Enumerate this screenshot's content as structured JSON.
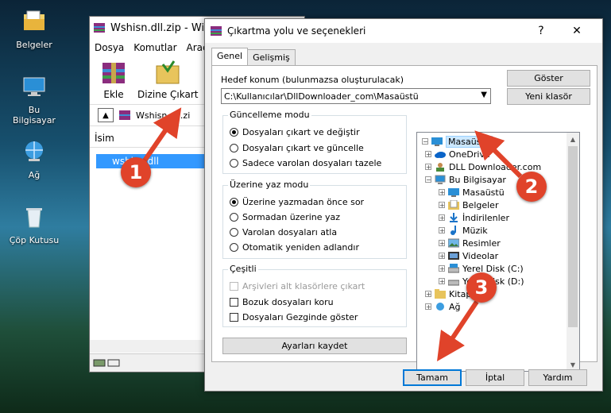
{
  "desktop": {
    "icons": [
      {
        "label": "Belgeler",
        "icon": "folder-documents-icon"
      },
      {
        "label": "Bu Bilgisayar",
        "icon": "computer-icon"
      },
      {
        "label": "Ağ",
        "icon": "network-icon"
      },
      {
        "label": "Çöp Kutusu",
        "icon": "recycle-bin-icon"
      }
    ]
  },
  "winrar": {
    "title": "Wshisn.dll.zip - WinR",
    "menu": [
      "Dosya",
      "Komutlar",
      "Araçla"
    ],
    "toolbar": {
      "add_label": "Ekle",
      "extract_label": "Dizine Çıkart"
    },
    "address": "Wshisn.dll.zi",
    "column_name": "İsim",
    "file_name": "wshisn.dll"
  },
  "dialog": {
    "title": "Çıkartma yolu ve seçenekleri",
    "help_glyph": "?",
    "close_glyph": "✕",
    "tabs": [
      "Genel",
      "Gelişmiş"
    ],
    "dest_label": "Hedef konum (bulunmazsa oluşturulacak)",
    "dest_value": "C:\\Kullanıcılar\\DllDownloader_com\\Masaüstü",
    "show_button": "Göster",
    "new_folder_button": "Yeni klasör",
    "update_mode": {
      "title": "Güncelleme modu",
      "options": [
        "Dosyaları çıkart ve değiştir",
        "Dosyaları çıkart ve güncelle",
        "Sadece varolan dosyaları tazele"
      ],
      "selected": 0
    },
    "overwrite_mode": {
      "title": "Üzerine yaz modu",
      "options": [
        "Üzerine yazmadan önce sor",
        "Sormadan üzerine yaz",
        "Varolan dosyaları atla",
        "Otomatik yeniden adlandır"
      ],
      "selected": 0
    },
    "misc": {
      "title": "Çeşitli",
      "options": [
        {
          "label": "Arşivleri alt klasörlere çıkart",
          "checked": false,
          "enabled": false
        },
        {
          "label": "Bozuk dosyaları koru",
          "checked": false,
          "enabled": true
        },
        {
          "label": "Dosyaları Gezginde göster",
          "checked": false,
          "enabled": true
        }
      ]
    },
    "save_settings_button": "Ayarları kaydet",
    "tree": [
      {
        "label": "Masaüstü",
        "icon": "desktop-folder-icon",
        "selected": true
      },
      {
        "label": "OneDrive",
        "icon": "onedrive-icon"
      },
      {
        "label": "DLL Downloader.com",
        "icon": "user-folder-icon"
      },
      {
        "label": "Bu Bilgisayar",
        "icon": "computer-icon"
      },
      {
        "label": "Masaüstü",
        "icon": "desktop-folder-icon"
      },
      {
        "label": "Belgeler",
        "icon": "documents-folder-icon"
      },
      {
        "label": "İndirilenler",
        "icon": "downloads-folder-icon"
      },
      {
        "label": "Müzik",
        "icon": "music-folder-icon"
      },
      {
        "label": "Resimler",
        "icon": "pictures-folder-icon"
      },
      {
        "label": "Videolar",
        "icon": "videos-folder-icon"
      },
      {
        "label": "Yerel Disk (C:)",
        "icon": "drive-icon"
      },
      {
        "label": "Yerel Disk (D:)",
        "icon": "drive-icon"
      },
      {
        "label": "Kitaplıklar",
        "icon": "libraries-folder-icon"
      },
      {
        "label": "Ağ",
        "icon": "network-icon"
      }
    ],
    "ok_button": "Tamam",
    "cancel_button": "İptal",
    "help_button": "Yardım"
  },
  "callouts": [
    "1",
    "2",
    "3"
  ],
  "colors": {
    "callout": "#e0432a",
    "selection": "#3399ff",
    "tree_selection": "#cce8ff",
    "accent": "#0078d7"
  }
}
